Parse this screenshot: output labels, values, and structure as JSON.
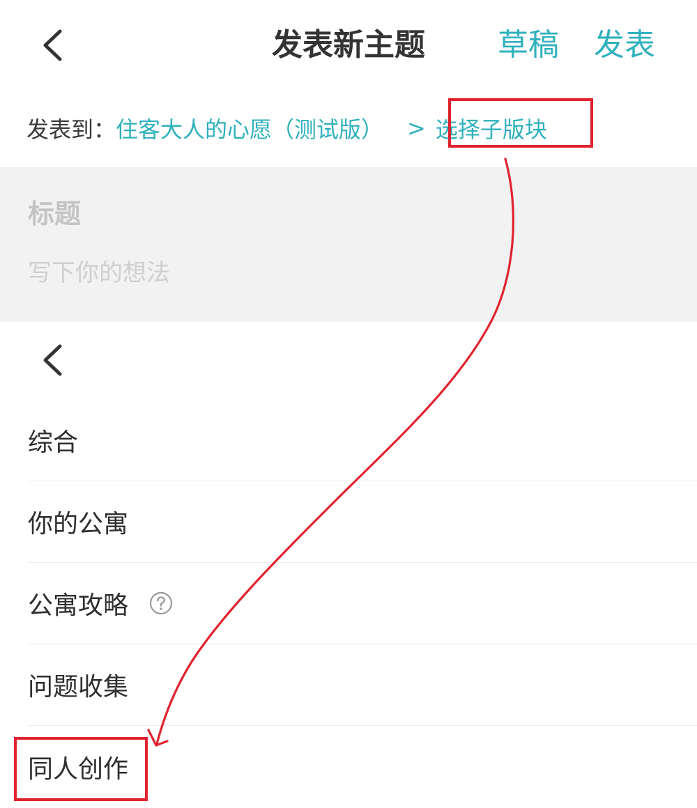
{
  "header": {
    "title": "发表新主题",
    "draft_label": "草稿",
    "publish_label": "发表"
  },
  "post_to": {
    "label": "发表到：",
    "forum_name": "住客大人的心愿（测试版）",
    "separator": ">",
    "sub_board_label": "选择子版块"
  },
  "editor": {
    "title_placeholder": "标题",
    "body_placeholder": "写下你的想法"
  },
  "sub_boards": {
    "items": [
      {
        "label": "综合",
        "has_help_icon": false
      },
      {
        "label": "你的公寓",
        "has_help_icon": false
      },
      {
        "label": "公寓攻略",
        "has_help_icon": true
      },
      {
        "label": "问题收集",
        "has_help_icon": false
      },
      {
        "label": "同人创作",
        "has_help_icon": false
      }
    ]
  },
  "colors": {
    "accent": "#2fb1bc",
    "annotation": "#e0232f",
    "editor_bg": "#f2f2f2"
  },
  "icons": {
    "back": "chevron-left-icon",
    "help": "question-circle-icon"
  }
}
